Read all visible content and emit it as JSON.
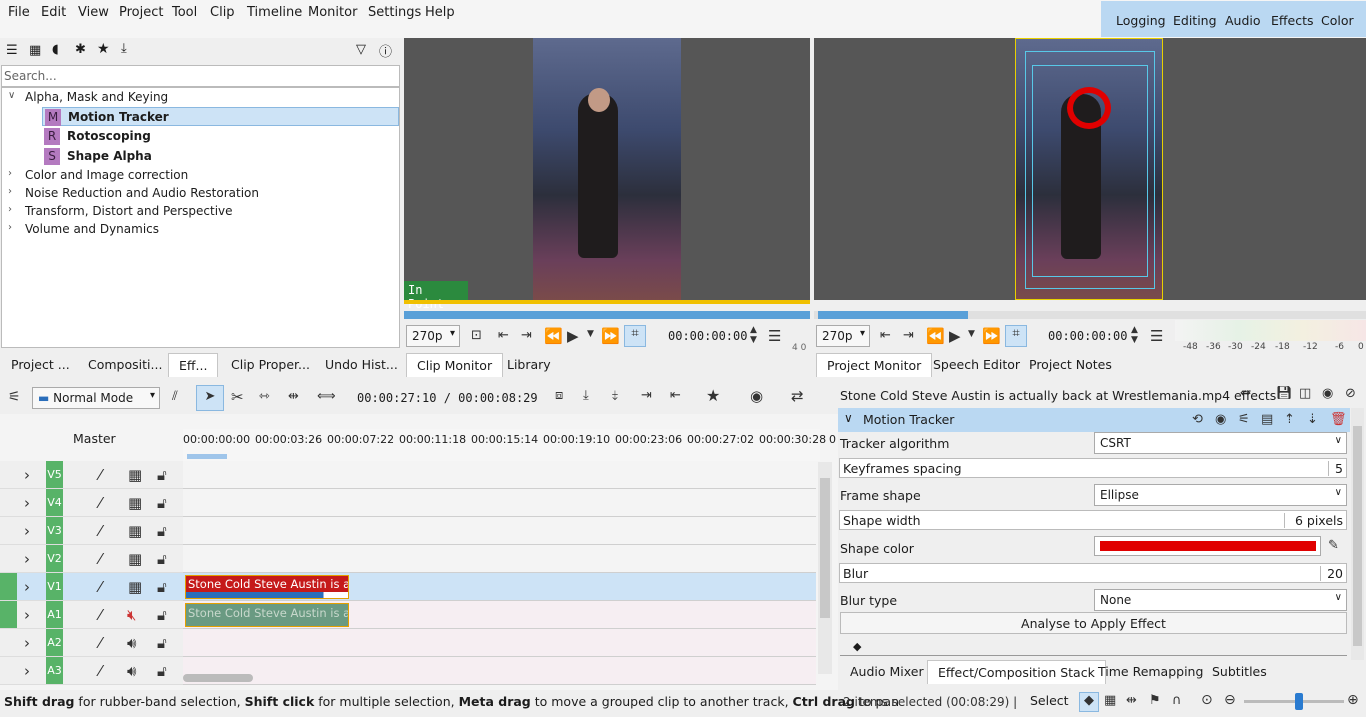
{
  "menu": [
    "File",
    "Edit",
    "View",
    "Project",
    "Tool",
    "Clip",
    "Timeline",
    "Monitor",
    "Settings",
    "Help"
  ],
  "workspaces": [
    "Logging",
    "Editing",
    "Audio",
    "Effects",
    "Color"
  ],
  "effects": {
    "search_placeholder": "Search...",
    "categories": [
      "Alpha, Mask and Keying",
      "Color and Image correction",
      "Noise Reduction and Audio Restoration",
      "Transform, Distort and Perspective",
      "Volume and Dynamics"
    ],
    "items": [
      {
        "icon": "M",
        "label": "Motion Tracker"
      },
      {
        "icon": "R",
        "label": "Rotoscoping"
      },
      {
        "icon": "S",
        "label": "Shape Alpha"
      }
    ]
  },
  "clip_monitor": {
    "overlay": "In Point",
    "resolution": "270p",
    "timecode": "00:00:00:00",
    "edge": "4 0"
  },
  "project_monitor": {
    "resolution": "270p",
    "timecode": "00:00:00:00"
  },
  "meter_labels": [
    "-48",
    "-36",
    "-30",
    "-24",
    "-18",
    "-12",
    "-6",
    "0"
  ],
  "left_tabs": [
    "Project ...",
    "Compositi...",
    "Eff...",
    "Clip Proper...",
    "Undo Hist..."
  ],
  "monitor_tabs": [
    "Clip Monitor",
    "Library"
  ],
  "project_tabs": [
    "Project Monitor",
    "Speech Editor",
    "Project Notes"
  ],
  "timeline": {
    "mode": "Normal Mode",
    "position": "00:00:27:10 / 00:00:08:29",
    "master": "Master",
    "ruler": [
      "00:00:00:00",
      "00:00:03:26",
      "00:00:07:22",
      "00:00:11:18",
      "00:00:15:14",
      "00:00:19:10",
      "00:00:23:06",
      "00:00:27:02",
      "00:00:30:28",
      "0"
    ],
    "tracks": [
      "V5",
      "V4",
      "V3",
      "V2",
      "V1",
      "A1",
      "A2",
      "A3"
    ],
    "clip_title": "Stone Cold Steve Austin is actu"
  },
  "effect_stack": {
    "title": "Stone Cold Steve Austin is actually back at Wrestlemania.mp4 effects",
    "effect_name": "Motion Tracker",
    "params": {
      "tracker_algorithm_label": "Tracker algorithm",
      "tracker_algorithm": "CSRT",
      "keyframes_label": "Keyframes spacing",
      "keyframes": "5",
      "frame_shape_label": "Frame shape",
      "frame_shape": "Ellipse",
      "shape_width_label": "Shape width",
      "shape_width": "6 pixels",
      "shape_color_label": "Shape color",
      "shape_color": "#e00000",
      "blur_label": "Blur",
      "blur": "20",
      "blur_type_label": "Blur type",
      "blur_type": "None",
      "analyse_label": "Analyse to Apply Effect"
    }
  },
  "bottom_tabs": [
    "Audio Mixer",
    "Effect/Composition Stack",
    "Time Remapping",
    "Subtitles"
  ],
  "status": {
    "b1": "Shift drag",
    "t1": " for rubber-band selection, ",
    "b2": "Shift click",
    "t2": " for multiple selection, ",
    "b3": "Meta drag",
    "t3": " to move a grouped clip to another track, ",
    "b4": "Ctrl drag",
    "t4": " to pan",
    "selected": "2 items selected (00:08:29) |",
    "select_label": "Select"
  }
}
